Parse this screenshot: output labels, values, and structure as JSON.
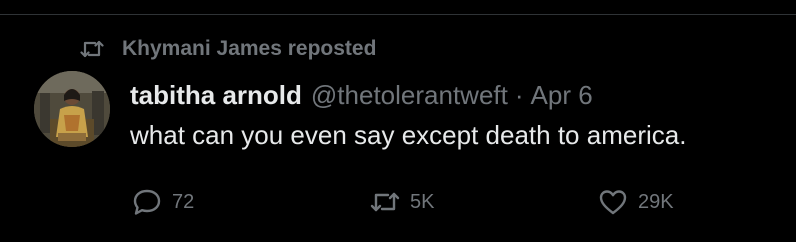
{
  "repost": {
    "label": "Khymani James reposted",
    "icon": "retweet-icon"
  },
  "tweet": {
    "author_name": "tabitha arnold",
    "handle": "@thetolerantweft",
    "separator": "·",
    "date": "Apr 6",
    "text": "what can you even say except death to america."
  },
  "actions": {
    "replies": "72",
    "reposts": "5K",
    "likes": "29K"
  },
  "colors": {
    "background": "#000000",
    "primary_text": "#e7e9ea",
    "secondary_text": "#71767b",
    "divider": "#2f3336"
  }
}
